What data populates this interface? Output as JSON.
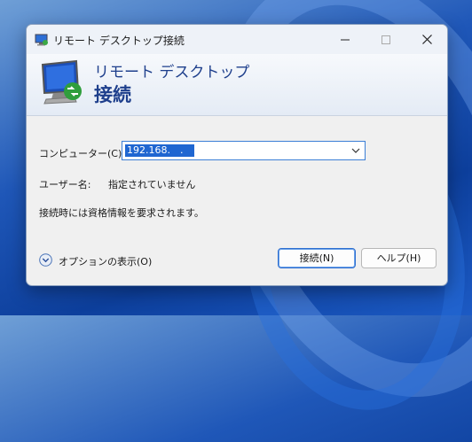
{
  "window": {
    "title": "リモート デスクトップ接続",
    "icon": "remote-desktop-icon"
  },
  "banner": {
    "line1": "リモート デスクトップ",
    "line2": "接続"
  },
  "form": {
    "computer_label": "コンピューター(C):",
    "computer_value": "192.168.　.",
    "user_label": "ユーザー名:",
    "user_value": "指定されていません",
    "info_text": "接続時には資格情報を要求されます。"
  },
  "footer": {
    "options_label": "オプションの表示(O)",
    "connect_label": "接続(N)",
    "help_label": "ヘルプ(H)"
  },
  "colors": {
    "accent": "#1f66d1",
    "banner_text": "#1e3f8c"
  }
}
